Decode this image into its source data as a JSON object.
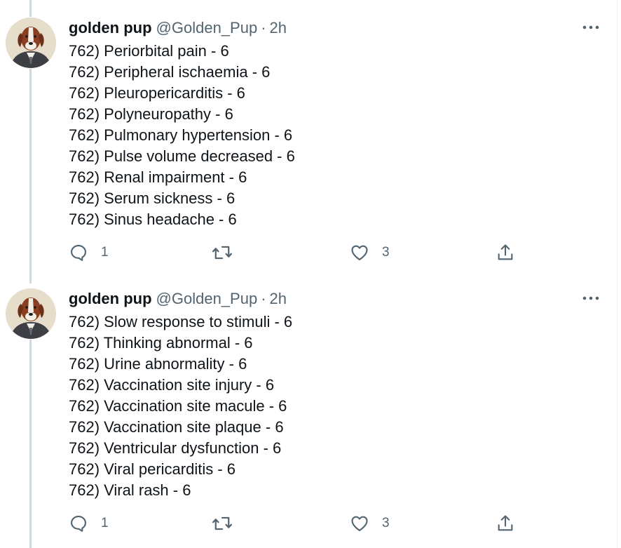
{
  "tweets": [
    {
      "author": {
        "name": "golden pup",
        "handle": "@Golden_Pup",
        "separator": "·",
        "time": "2h"
      },
      "lines": [
        "762) Periorbital pain - 6",
        "762) Peripheral ischaemia - 6",
        "762) Pleuropericarditis - 6",
        "762) Polyneuropathy - 6",
        "762) Pulmonary hypertension - 6",
        "762) Pulse volume decreased - 6",
        "762) Renal impairment - 6",
        "762) Serum sickness - 6",
        "762) Sinus headache - 6"
      ],
      "actions": {
        "replies": "1",
        "retweets": "",
        "likes": "3"
      }
    },
    {
      "author": {
        "name": "golden pup",
        "handle": "@Golden_Pup",
        "separator": "·",
        "time": "2h"
      },
      "lines": [
        "762) Slow response to stimuli - 6",
        "762) Thinking abnormal - 6",
        "762) Urine abnormality - 6",
        "762) Vaccination site injury - 6",
        "762) Vaccination site macule - 6",
        "762) Vaccination site plaque - 6",
        "762) Ventricular dysfunction - 6",
        "762) Viral pericarditis - 6",
        "762) Viral rash - 6"
      ],
      "actions": {
        "replies": "1",
        "retweets": "",
        "likes": "3"
      }
    }
  ],
  "icons": {
    "avatar": "dog-portrait-avatar",
    "more": "more-options-icon",
    "reply": "reply-icon",
    "retweet": "retweet-icon",
    "like": "heart-icon",
    "share": "share-icon"
  },
  "colors": {
    "text": "#0f1419",
    "secondary": "#536471",
    "thread_line": "#cfd9de",
    "divider": "#eff3f4"
  }
}
